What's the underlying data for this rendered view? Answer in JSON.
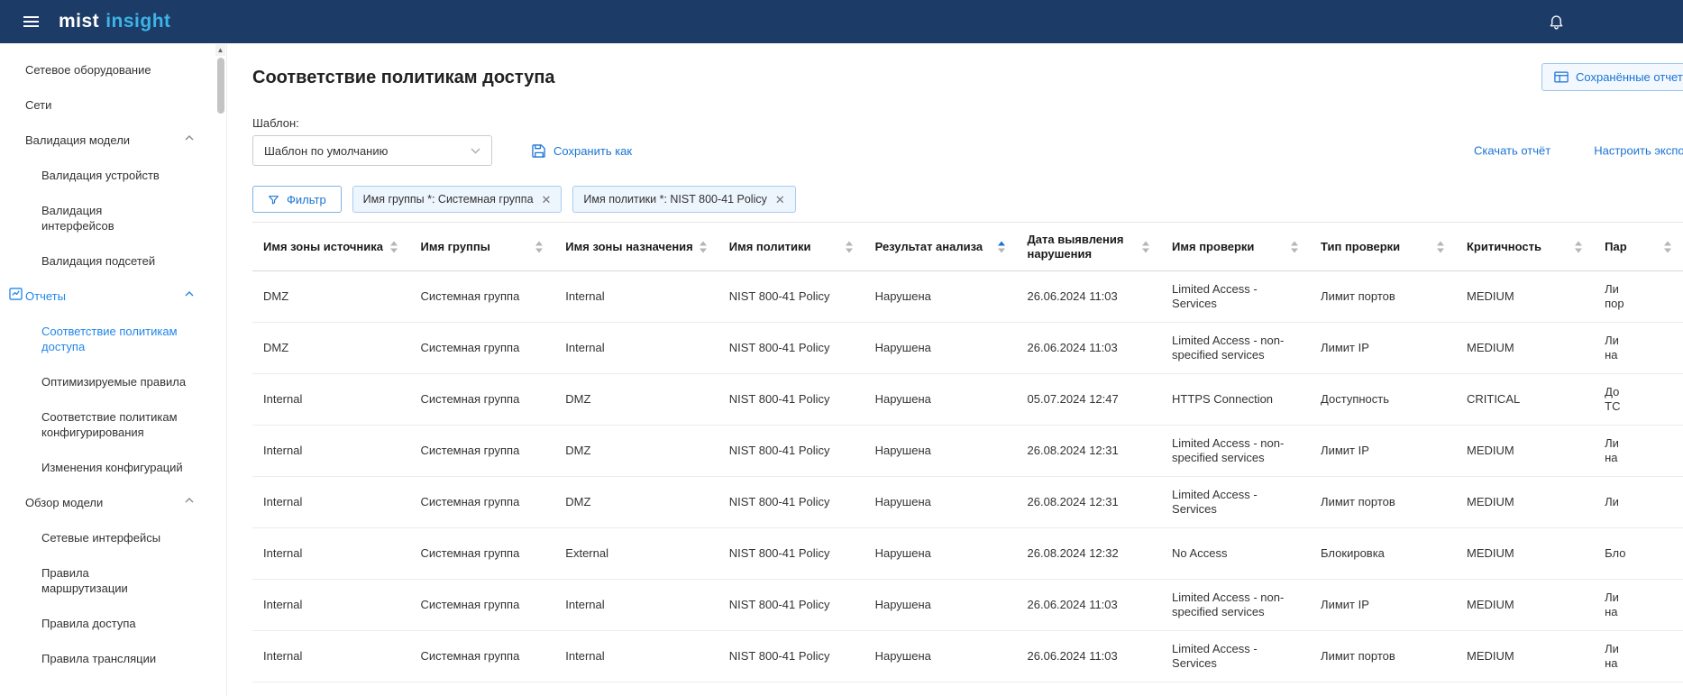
{
  "topbar": {
    "brand_mist": "mist",
    "brand_insight": "insight"
  },
  "sidebar": {
    "items": [
      {
        "id": "network-equipment",
        "label": "Сетевое оборудование",
        "level": 0
      },
      {
        "id": "networks",
        "label": "Сети",
        "level": 0
      },
      {
        "id": "model-validation",
        "label": "Валидация модели",
        "level": 0,
        "chevron": true
      },
      {
        "id": "device-validation",
        "label": "Валидация устройств",
        "level": 1
      },
      {
        "id": "interface-validation",
        "label": "Валидация\nинтерфейсов",
        "level": 1
      },
      {
        "id": "subnet-validation",
        "label": "Валидация подсетей",
        "level": 1
      },
      {
        "id": "reports",
        "label": "Отчеты",
        "level": 0,
        "chevron": true,
        "icon": "reports-icon",
        "section_active": true
      },
      {
        "id": "access-policy-compliance",
        "label": "Соответствие политикам\nдоступа",
        "level": 1,
        "active": true
      },
      {
        "id": "optimizable-rules",
        "label": "Оптимизируемые правила",
        "level": 1
      },
      {
        "id": "config-policy-compliance",
        "label": "Соответствие политикам\nконфигурирования",
        "level": 1
      },
      {
        "id": "config-changes",
        "label": "Изменения конфигураций",
        "level": 1
      },
      {
        "id": "model-overview",
        "label": "Обзор модели",
        "level": 0,
        "chevron": true
      },
      {
        "id": "network-interfaces",
        "label": "Сетевые интерфейсы",
        "level": 1
      },
      {
        "id": "routing-rules",
        "label": "Правила\nмаршрутизации",
        "level": 1
      },
      {
        "id": "access-rules",
        "label": "Правила доступа",
        "level": 1
      },
      {
        "id": "translation-rules",
        "label": "Правила трансляции",
        "level": 1
      }
    ]
  },
  "page": {
    "title": "Соответствие политикам доступа",
    "saved_reports_button": "Сохранённые отчеты",
    "template_label": "Шаблон:",
    "template_value": "Шаблон по умолчанию",
    "save_as_link": "Сохранить как",
    "download_link": "Скачать отчёт",
    "export_link": "Настроить экспорт",
    "filter_button": "Фильтр",
    "filter_chips": [
      {
        "label": "Имя группы *: Системная группа"
      },
      {
        "label": "Имя политики *: NIST 800-41 Policy"
      }
    ]
  },
  "table": {
    "columns": [
      {
        "key": "source_zone",
        "label": "Имя зоны источника",
        "sort": "none"
      },
      {
        "key": "group",
        "label": "Имя группы",
        "sort": "none"
      },
      {
        "key": "dest_zone",
        "label": "Имя зоны назначения",
        "sort": "none"
      },
      {
        "key": "policy",
        "label": "Имя политики",
        "sort": "none"
      },
      {
        "key": "result",
        "label": "Результат анализа",
        "sort": "asc"
      },
      {
        "key": "date",
        "label": "Дата выявления нарушения",
        "sort": "none",
        "wrap": true
      },
      {
        "key": "check_name",
        "label": "Имя проверки",
        "sort": "none"
      },
      {
        "key": "check_type",
        "label": "Тип проверки",
        "sort": "none"
      },
      {
        "key": "criticality",
        "label": "Критичность",
        "sort": "none"
      },
      {
        "key": "params",
        "label": "Пар",
        "sort": "none"
      }
    ],
    "rows": [
      {
        "source_zone": "DMZ",
        "group": "Системная группа",
        "dest_zone": "Internal",
        "policy": "NIST 800-41 Policy",
        "result": "Нарушена",
        "date": "26.06.2024 11:03",
        "check_name": "Limited Access - Services",
        "check_type": "Лимит портов",
        "criticality": "MEDIUM",
        "params": "Ли\nпор"
      },
      {
        "source_zone": "DMZ",
        "group": "Системная группа",
        "dest_zone": "Internal",
        "policy": "NIST 800-41 Policy",
        "result": "Нарушена",
        "date": "26.06.2024 11:03",
        "check_name": "Limited Access - non-specified services",
        "check_type": "Лимит IP",
        "criticality": "MEDIUM",
        "params": "Ли\nна"
      },
      {
        "source_zone": "Internal",
        "group": "Системная группа",
        "dest_zone": "DMZ",
        "policy": "NIST 800-41 Policy",
        "result": "Нарушена",
        "date": "05.07.2024 12:47",
        "check_name": "HTTPS Connection",
        "check_type": "Доступность",
        "criticality": "CRITICAL",
        "params": "До\nТС"
      },
      {
        "source_zone": "Internal",
        "group": "Системная группа",
        "dest_zone": "DMZ",
        "policy": "NIST 800-41 Policy",
        "result": "Нарушена",
        "date": "26.08.2024 12:31",
        "check_name": "Limited Access - non-specified services",
        "check_type": "Лимит IP",
        "criticality": "MEDIUM",
        "params": "Ли\nна"
      },
      {
        "source_zone": "Internal",
        "group": "Системная группа",
        "dest_zone": "DMZ",
        "policy": "NIST 800-41 Policy",
        "result": "Нарушена",
        "date": "26.08.2024 12:31",
        "check_name": "Limited Access - Services",
        "check_type": "Лимит портов",
        "criticality": "MEDIUM",
        "params": "Ли"
      },
      {
        "source_zone": "Internal",
        "group": "Системная группа",
        "dest_zone": "External",
        "policy": "NIST 800-41 Policy",
        "result": "Нарушена",
        "date": "26.08.2024 12:32",
        "check_name": "No Access",
        "check_type": "Блокировка",
        "criticality": "MEDIUM",
        "params": "Бло"
      },
      {
        "source_zone": "Internal",
        "group": "Системная группа",
        "dest_zone": "Internal",
        "policy": "NIST 800-41 Policy",
        "result": "Нарушена",
        "date": "26.06.2024 11:03",
        "check_name": "Limited Access - non-specified services",
        "check_type": "Лимит IP",
        "criticality": "MEDIUM",
        "params": "Ли\nна"
      },
      {
        "source_zone": "Internal",
        "group": "Системная группа",
        "dest_zone": "Internal",
        "policy": "NIST 800-41 Policy",
        "result": "Нарушена",
        "date": "26.06.2024 11:03",
        "check_name": "Limited Access - Services",
        "check_type": "Лимит портов",
        "criticality": "MEDIUM",
        "params": "Ли\nна"
      }
    ]
  },
  "colors": {
    "topbar_bg": "#1d3b67",
    "brand_insight_blue": "#3cb4e7",
    "accent_blue": "#1b74d4",
    "active_item_blue": "#2186eb"
  }
}
